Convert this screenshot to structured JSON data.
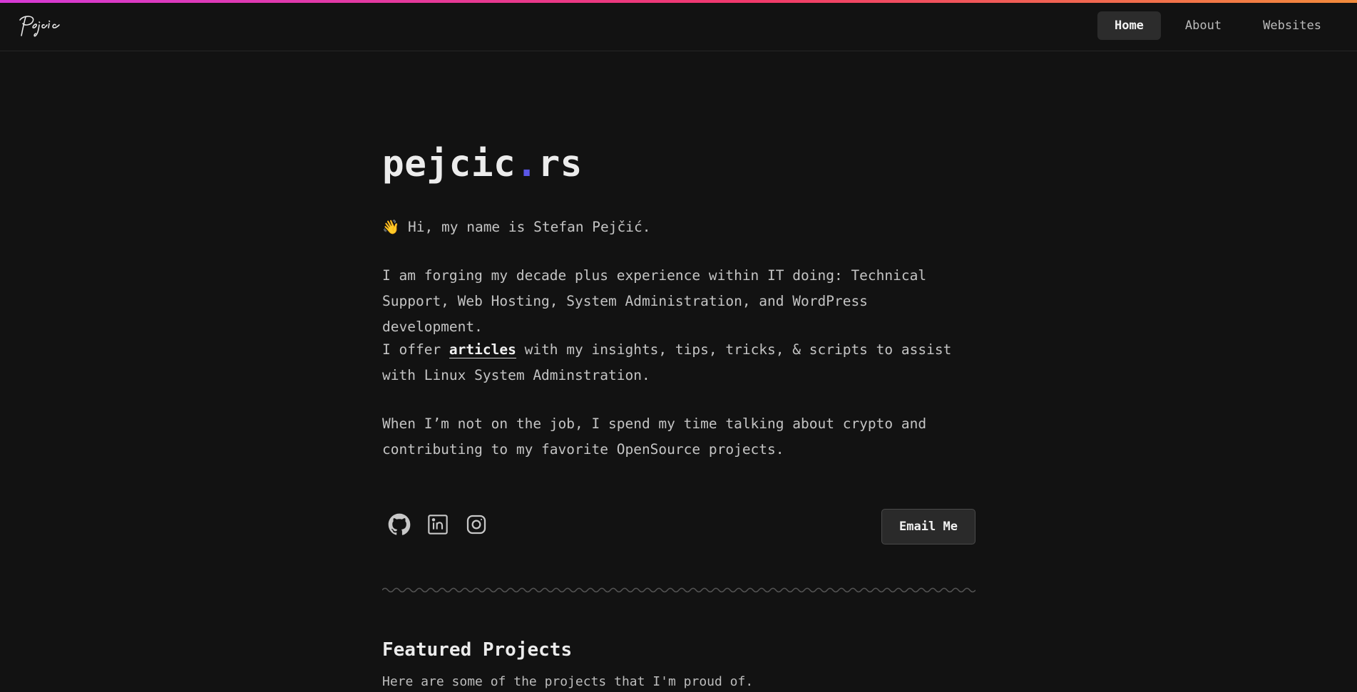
{
  "header": {
    "logo_text": "Pejcic",
    "nav": [
      {
        "label": "Home",
        "active": true
      },
      {
        "label": "About",
        "active": false
      },
      {
        "label": "Websites",
        "active": false
      }
    ]
  },
  "hero": {
    "title_main": "pejcic",
    "title_dot": ".",
    "title_tld": "rs",
    "greeting_emoji": "👋",
    "greeting": "Hi, my name is Stefan Pejčić.",
    "experience": "I am forging my decade plus experience within IT doing: Technical Support, Web Hosting, System Administration, and WordPress development.",
    "articles_before": "I offer ",
    "articles_link": "articles",
    "articles_after": " with my insights, tips, tricks, & scripts to assist with Linux System Adminstration.",
    "job": "When I’m not on the job, I spend my time talking about crypto and contributing to my favorite OpenSource projects."
  },
  "socials": [
    {
      "icon": "github-icon"
    },
    {
      "icon": "linkedin-icon"
    },
    {
      "icon": "instagram-icon"
    }
  ],
  "email_button": "Email Me",
  "featured": {
    "heading": "Featured Projects",
    "subtitle": "Here are some of the projects that I'm proud of."
  },
  "colors": {
    "background": "#121212",
    "accent_dot": "#5b57e6",
    "gradient": [
      "#d63ad6",
      "#f0386b",
      "#f28b3b"
    ]
  }
}
